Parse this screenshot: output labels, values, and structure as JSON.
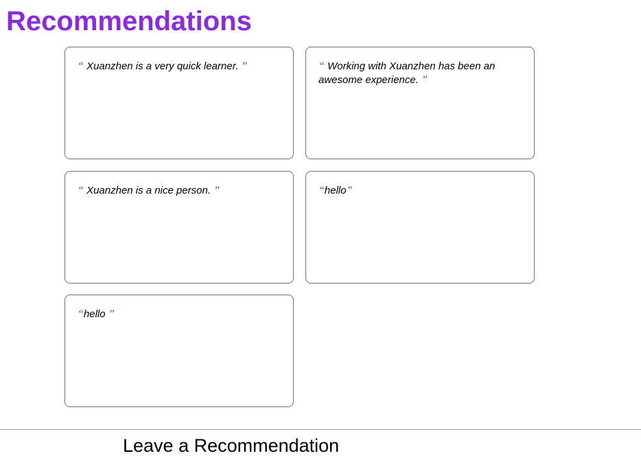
{
  "page": {
    "title": "Recommendations"
  },
  "quotes": {
    "open": "“",
    "close": "”"
  },
  "recommendations": [
    {
      "text": " Xuanzhen is a very quick learner. "
    },
    {
      "text": " Working with Xuanzhen has been an awesome experience. "
    },
    {
      "text": " Xuanzhen is a nice person. "
    },
    {
      "text": "hello"
    },
    {
      "text": "hello "
    }
  ],
  "form": {
    "heading": "Leave a Recommendation"
  },
  "colors": {
    "accent": "#8a2be2",
    "border": "#707070",
    "divider": "#9a9a9a"
  }
}
